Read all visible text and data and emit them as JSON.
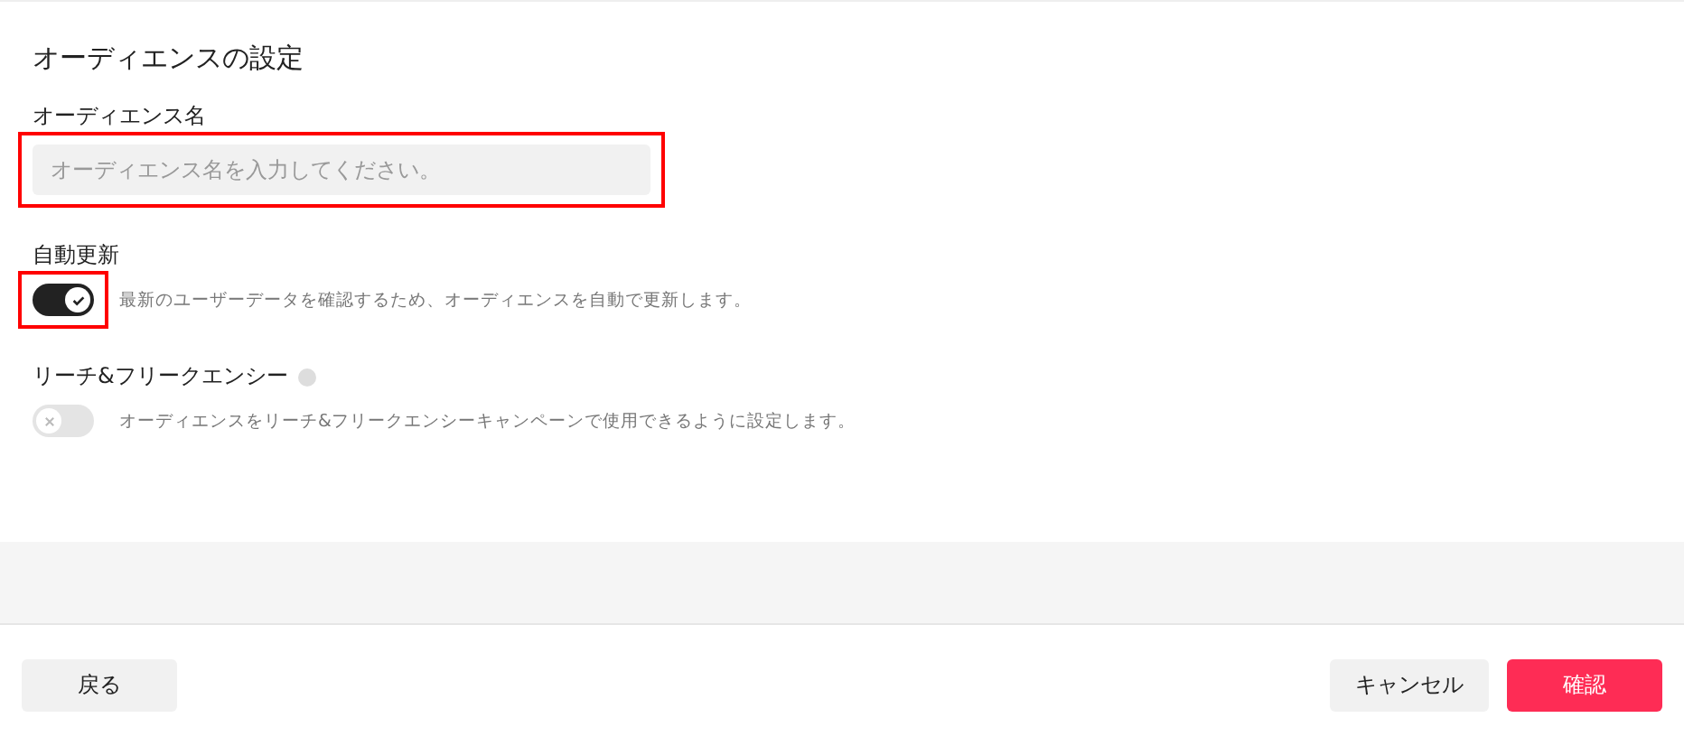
{
  "title": "オーディエンスの設定",
  "name_field": {
    "label": "オーディエンス名",
    "placeholder": "オーディエンス名を入力してください。",
    "highlighted": true
  },
  "settings": [
    {
      "label": "自動更新",
      "help": false,
      "on": true,
      "highlighted": true,
      "description": "最新のユーザーデータを確認するため、オーディエンスを自動で更新します。"
    },
    {
      "label": "リーチ&フリークエンシー",
      "help": true,
      "on": false,
      "highlighted": false,
      "description": "オーディエンスをリーチ&フリークエンシーキャンペーンで使用できるように設定します。"
    }
  ],
  "footer": {
    "back": "戻る",
    "cancel": "キャンセル",
    "confirm": "確認"
  }
}
